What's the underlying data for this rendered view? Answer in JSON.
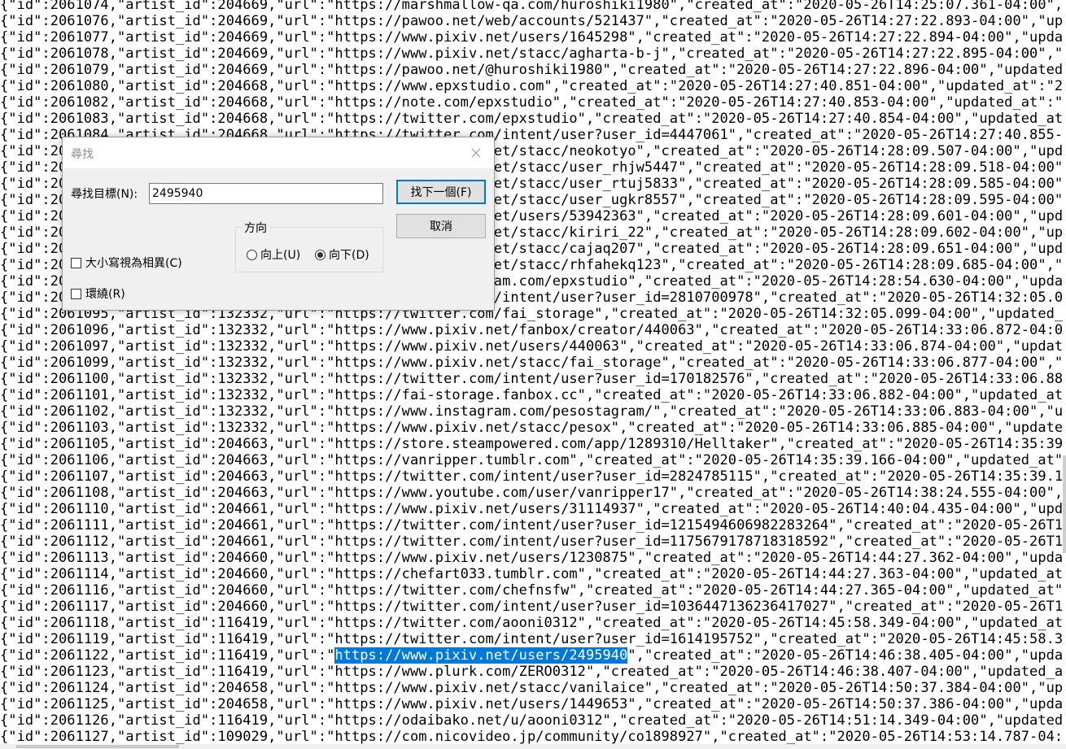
{
  "editor": {
    "lines": [
      "{\"id\":2061074,\"artist_id\":204669,\"url\":\"https://marshmallow-qa.com/huroshiki1980\",\"created_at\":\"2020-05-26T14:25:07.361-04:00\",\"updated_at\":\"2020-",
      "{\"id\":2061076,\"artist_id\":204669,\"url\":\"https://pawoo.net/web/accounts/521437\",\"created_at\":\"2020-05-26T14:27:22.893-04:00\",\"updated_at\":\"2",
      "{\"id\":2061077,\"artist_id\":204669,\"url\":\"https://www.pixiv.net/users/1645298\",\"created_at\":\"2020-05-26T14:27:22.894-04:00\",\"updated_at\":\"2",
      "{\"id\":2061078,\"artist_id\":204669,\"url\":\"https://www.pixiv.net/stacc/agharta-b-j\",\"created_at\":\"2020-05-26T14:27:22.895-04:00\",\"updated_at\"",
      "{\"id\":2061079,\"artist_id\":204669,\"url\":\"https://pawoo.net/@huroshiki1980\",\"created_at\":\"2020-05-26T14:27:22.896-04:00\",\"updated_at\":\"2020-",
      "{\"id\":2061080,\"artist_id\":204668,\"url\":\"https://www.epxstudio.com\",\"created_at\":\"2020-05-26T14:27:40.851-04:00\",\"updated_at\":\"2020-05-26T1",
      "{\"id\":2061082,\"artist_id\":204668,\"url\":\"https://note.com/epxstudio\",\"created_at\":\"2020-05-26T14:27:40.853-04:00\",\"updated_at\":\"2020-05-26T",
      "{\"id\":2061083,\"artist_id\":204668,\"url\":\"https://twitter.com/epxstudio\",\"created_at\":\"2020-05-26T14:27:40.854-04:00\",\"updated_at\":\"2020-05-",
      "{\"id\":2061084,\"artist_id\":204668,\"url\":\"https://twitter.com/intent/user?user_id=4447061\",\"created_at\":\"2020-05-26T14:27:40.855-04:00\",\"upda",
      "{\"id\":2061085,\"artist_id\":204667,\"url\":\"https://www.pixiv.net/stacc/neokotyo\",\"created_at\":\"2020-05-26T14:28:09.507-04:00\",\"updated_at\":\"2",
      "{\"id\":2061086,\"artist_id\":204667,\"url\":\"https://www.pixiv.net/stacc/user_rhjw5447\",\"created_at\":\"2020-05-26T14:28:09.518-04:00\",\"updated_",
      "{\"id\":2061087,\"artist_id\":204667,\"url\":\"https://www.pixiv.net/stacc/user_rtuj5833\",\"created_at\":\"2020-05-26T14:28:09.585-04:00\",\"updated_",
      "{\"id\":2061088,\"artist_id\":204667,\"url\":\"https://www.pixiv.net/stacc/user_ugkr8557\",\"created_at\":\"2020-05-26T14:28:09.595-04:00\",\"updated_",
      "{\"id\":2061089,\"artist_id\":204667,\"url\":\"https://www.pixiv.net/users/53942363\",\"created_at\":\"2020-05-26T14:28:09.601-04:00\",\"updated_at\":\"2",
      "{\"id\":2061090,\"artist_id\":204667,\"url\":\"https://www.pixiv.net/stacc/kiriri_22\",\"created_at\":\"2020-05-26T14:28:09.602-04:00\",\"updated_at\":",
      "{\"id\":2061091,\"artist_id\":204667,\"url\":\"https://www.pixiv.net/stacc/cajaq207\",\"created_at\":\"2020-05-26T14:28:09.651-04:00\",\"updated_at\":\"",
      "{\"id\":2061092,\"artist_id\":204667,\"url\":\"https://www.pixiv.net/stacc/rhfahekq123\",\"created_at\":\"2020-05-26T14:28:09.685-04:00\",\"updated_at",
      "{\"id\":2061093,\"artist_id\":204668,\"url\":\"https://www.instagram.com/epxstudio\",\"created_at\":\"2020-05-26T14:28:54.630-04:00\",\"updated_at\":\"",
      "{\"id\":2061094,\"artist_id\":132332,\"url\":\"https://twitter.com/intent/user?user_id=2810700978\",\"created_at\":\"2020-05-26T14:32:05.098-04:00\",",
      "{\"id\":2061095,\"artist_id\":132332,\"url\":\"https://twitter.com/fai_storage\",\"created_at\":\"2020-05-26T14:32:05.099-04:00\",\"updated_at\":\"2020-05",
      "{\"id\":2061096,\"artist_id\":132332,\"url\":\"https://www.pixiv.net/fanbox/creator/440063\",\"created_at\":\"2020-05-26T14:33:06.872-04:00\",\"updated",
      "{\"id\":2061097,\"artist_id\":132332,\"url\":\"https://www.pixiv.net/users/440063\",\"created_at\":\"2020-05-26T14:33:06.874-04:00\",\"updated_at\":\"20",
      "{\"id\":2061099,\"artist_id\":132332,\"url\":\"https://www.pixiv.net/stacc/fai_storage\",\"created_at\":\"2020-05-26T14:33:06.877-04:00\",\"updated_at\"",
      "{\"id\":2061100,\"artist_id\":132332,\"url\":\"https://twitter.com/intent/user?user_id=170182576\",\"created_at\":\"2020-05-26T14:33:06.880-04:00\",\"up",
      "{\"id\":2061101,\"artist_id\":132332,\"url\":\"https://fai-storage.fanbox.cc\",\"created_at\":\"2020-05-26T14:33:06.882-04:00\",\"updated_at\":\"2020-05-2",
      "{\"id\":2061102,\"artist_id\":132332,\"url\":\"https://www.instagram.com/pesostagram/\",\"created_at\":\"2020-05-26T14:33:06.883-04:00\",\"updated_at\"",
      "{\"id\":2061103,\"artist_id\":132332,\"url\":\"https://www.pixiv.net/stacc/pesox\",\"created_at\":\"2020-05-26T14:33:06.885-04:00\",\"updated_at\":\"202",
      "{\"id\":2061105,\"artist_id\":204663,\"url\":\"https://store.steampowered.com/app/1289310/Helltaker\",\"created_at\":\"2020-05-26T14:35:39.165-04:00\"",
      "{\"id\":2061106,\"artist_id\":204663,\"url\":\"https://vanripper.tumblr.com\",\"created_at\":\"2020-05-26T14:35:39.166-04:00\",\"updated_at\":\"2020-05-2",
      "{\"id\":2061107,\"artist_id\":204663,\"url\":\"https://twitter.com/intent/user?user_id=2824785115\",\"created_at\":\"2020-05-26T14:35:39.167-04:00\",",
      "{\"id\":2061108,\"artist_id\":204663,\"url\":\"https://www.youtube.com/user/vanripper17\",\"created_at\":\"2020-05-26T14:38:24.555-04:00\",\"updated_at",
      "{\"id\":2061110,\"artist_id\":204661,\"url\":\"https://www.pixiv.net/users/31114937\",\"created_at\":\"2020-05-26T14:40:04.435-04:00\",\"updated_at\":\"2",
      "{\"id\":2061111,\"artist_id\":204661,\"url\":\"https://twitter.com/intent/user?user_id=1215494606982283264\",\"created_at\":\"2020-05-26T14:40:04.436",
      "{\"id\":2061112,\"artist_id\":204661,\"url\":\"https://twitter.com/intent/user?user_id=1175679178718318592\",\"created_at\":\"2020-05-26T14:40:04.437",
      "{\"id\":2061113,\"artist_id\":204660,\"url\":\"https://www.pixiv.net/users/1230875\",\"created_at\":\"2020-05-26T14:44:27.362-04:00\",\"updated_at\":\"20",
      "{\"id\":2061114,\"artist_id\":204660,\"url\":\"https://chefart033.tumblr.com\",\"created_at\":\"2020-05-26T14:44:27.363-04:00\",\"updated_at\":\"2020-05-",
      "{\"id\":2061116,\"artist_id\":204660,\"url\":\"https://twitter.com/chefnsfw\",\"created_at\":\"2020-05-26T14:44:27.365-04:00\",\"updated_at\":\"2020-05-2",
      "{\"id\":2061117,\"artist_id\":204660,\"url\":\"https://twitter.com/intent/user?user_id=1036447136236417027\",\"created_at\":\"2020-05-26T14:44:27.367",
      "{\"id\":2061118,\"artist_id\":116419,\"url\":\"https://twitter.com/aooni0312\",\"created_at\":\"2020-05-26T14:45:58.349-04:00\",\"updated_at\":\"2020-05",
      "{\"id\":2061119,\"artist_id\":116419,\"url\":\"https://twitter.com/intent/user?user_id=1614195752\",\"created_at\":\"2020-05-26T14:45:58.350-04:00\",",
      "{\"id\":2061122,\"artist_id\":116419,\"url\":\"",
      "{\"id\":2061123,\"artist_id\":116419,\"url\":\"https://www.plurk.com/ZERO0312\",\"created_at\":\"2020-05-26T14:46:38.407-04:00\",\"updated_at\":\"2020-05",
      "{\"id\":2061124,\"artist_id\":204658,\"url\":\"https://www.pixiv.net/stacc/vanilaice\",\"created_at\":\"2020-05-26T14:50:37.384-04:00\",\"updated_at\":",
      "{\"id\":2061125,\"artist_id\":204658,\"url\":\"https://www.pixiv.net/users/1449653\",\"created_at\":\"2020-05-26T14:50:37.386-04:00\",\"updated_at\":\"20",
      "{\"id\":2061126,\"artist_id\":116419,\"url\":\"https://odaibako.net/u/aooni0312\",\"created_at\":\"2020-05-26T14:51:14.349-04:00\",\"updated_at\":\"2020-",
      "{\"id\":2061127,\"artist_id\":109029,\"url\":\"https://com.nicovideo.jp/community/co1898927\",\"created_at\":\"2020-05-26T14:53:14.787-04:00\",\"updated"
    ],
    "highlight_line_index": 40,
    "highlight_before": "{\"id\":2061122,\"artist_id\":116419,\"url\":\"",
    "highlight_text": "https://www.pixiv.net/users/2495940",
    "highlight_after": "\",\"created_at\":\"2020-05-26T14:46:38.405-04:00\",\"updated_at\":\"20"
  },
  "find_dialog": {
    "title": "尋找",
    "find_label": "尋找目標(N):",
    "find_value": "2495940",
    "find_next_label": "找下一個(F)",
    "cancel_label": "取消",
    "direction_label": "方向",
    "direction_up_label": "向上(U)",
    "direction_down_label": "向下(D)",
    "direction_selected": "down",
    "match_case_label": "大小寫視為相異(C)",
    "match_case_checked": false,
    "wrap_around_label": "環繞(R)",
    "wrap_around_checked": false
  }
}
